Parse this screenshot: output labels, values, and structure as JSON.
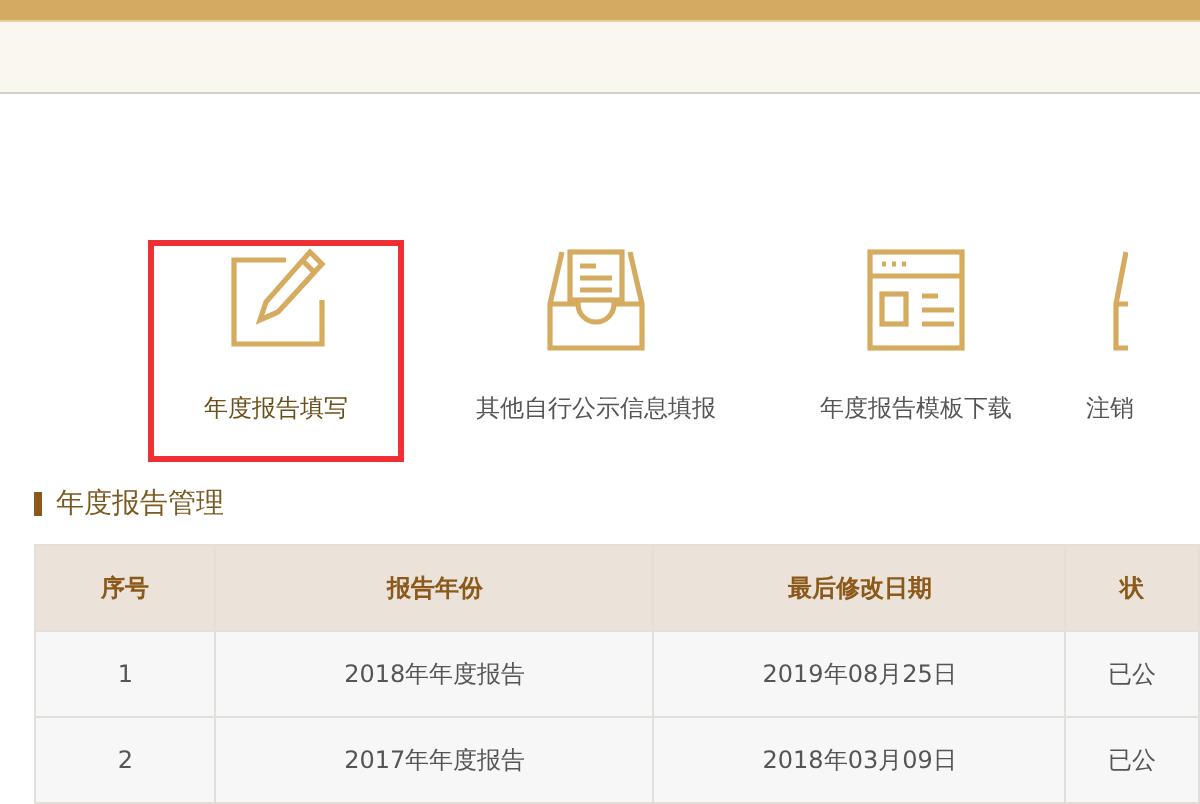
{
  "actions": [
    {
      "label": "年度报告填写",
      "kind": "pencil",
      "selected": true
    },
    {
      "label": "其他自行公示信息填报",
      "kind": "tray",
      "selected": false
    },
    {
      "label": "年度报告模板下载",
      "kind": "template",
      "selected": false
    },
    {
      "label": "注销",
      "kind": "partial",
      "selected": false
    }
  ],
  "section": {
    "title": "年度报告管理"
  },
  "table": {
    "columns": [
      "序号",
      "报告年份",
      "最后修改日期",
      "状"
    ],
    "rows": [
      [
        "1",
        "2018年年度报告",
        "2019年08月25日",
        "已公"
      ],
      [
        "2",
        "2017年年度报告",
        "2018年03月09日",
        "已公"
      ]
    ]
  }
}
